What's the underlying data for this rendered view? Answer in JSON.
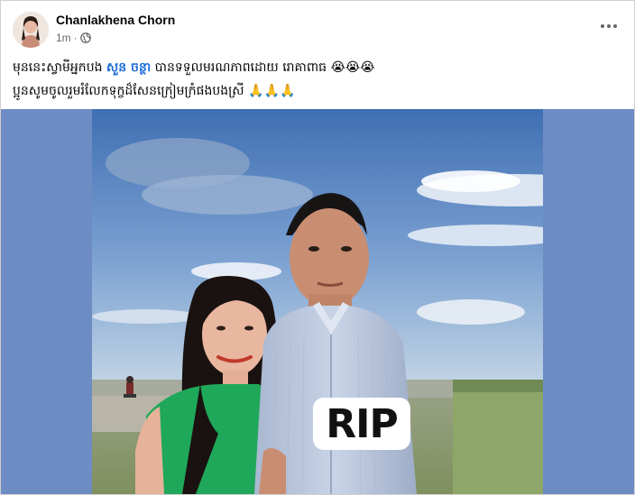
{
  "post": {
    "author": "Chanlakhena Chorn",
    "time": "1m",
    "time_separator": "·",
    "privacy_icon": "globe-icon",
    "more_icon": "more-horizontal-icon",
    "more_symbol": "···",
    "caption": {
      "line1_before": "មុននេះស្វាមីអ្នកបង ",
      "line1_mention": "សួន ចន្ថា",
      "line1_after": " បានទទួលមរណភាពដោយ រោគាពាធ ",
      "line1_emoji": "😭😭😭",
      "line2_text": "ប្អូនសូមចូលរួមរំលែកទុក្ខដ៏សែនក្រៀមក្រំផងបងស្រី ",
      "line2_emoji": "🙏🙏🙏"
    },
    "media": {
      "overlay_text": "RIP",
      "colors": {
        "background": "#6e8cc4",
        "sky_top": "#3f6fb3",
        "sky_bottom": "#c4d6e6",
        "grass": "#8fa46a",
        "woman_dress": "#1fa85a",
        "man_shirt": "#b9c6dc"
      }
    }
  }
}
